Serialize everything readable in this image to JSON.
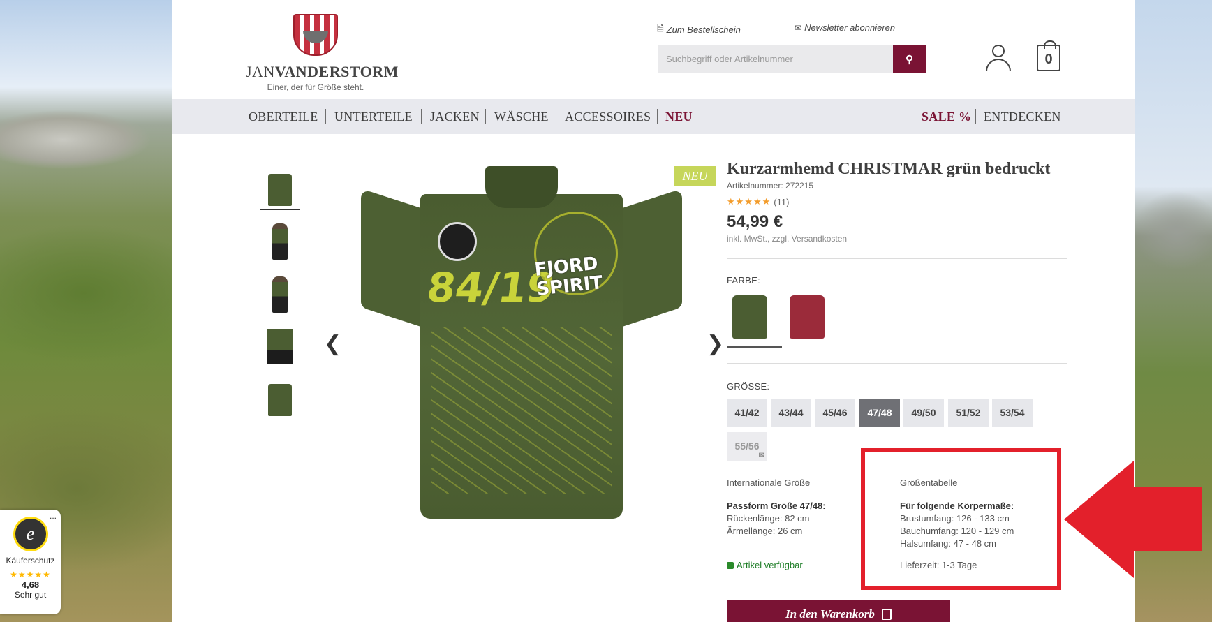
{
  "header": {
    "logo_name_light": "JAN",
    "logo_name_bold": "VANDERSTORM",
    "logo_tagline": "Einer, der für Größe steht.",
    "order_form_link": "Zum Bestellschein",
    "newsletter_link": "Newsletter abonnieren",
    "search_placeholder": "Suchbegriff oder Artikelnummer",
    "search_button_icon": "search-icon",
    "cart_count": "0"
  },
  "nav": {
    "left": [
      "OBERTEILE",
      "UNTERTEILE",
      "JACKEN",
      "WÄSCHE",
      "ACCESSOIRES",
      "NEU"
    ],
    "right": [
      "SALE %",
      "ENTDECKEN"
    ],
    "accent_color": "#7a1334"
  },
  "product": {
    "badge": "NEU",
    "title": "Kurzarmhemd CHRISTMAR grün bedruckt",
    "article_number": "Artikelnummer: 272215",
    "rating_stars": "★★★★★",
    "rating_count": "(11)",
    "price": "54,99 €",
    "vat_note": "inkl. MwSt., zzgl. Versandkosten",
    "print_number": "84/19",
    "print_text_1": "FJORD",
    "print_text_2": "SPIRIT",
    "color_label": "FARBE:",
    "colors": [
      {
        "name": "green",
        "hex": "#4b5d32"
      },
      {
        "name": "red",
        "hex": "#9b2b3a"
      }
    ],
    "size_label": "GRÖSSE:",
    "sizes": [
      "41/42",
      "43/44",
      "45/46",
      "47/48",
      "49/50",
      "51/52",
      "53/54",
      "55/56"
    ],
    "selected_size": "47/48",
    "unavailable_size": "55/56",
    "intl_size_link": "Internationale Größe",
    "size_table_link": "Größentabelle",
    "fit_title": "Passform Größe 47/48:",
    "fit_back_length": "Rückenlänge: 82 cm",
    "fit_sleeve_length": "Ärmellänge: 26 cm",
    "body_title": "Für folgende Körpermaße:",
    "chest": "Brustumfang: 126 - 133 cm",
    "waist": "Bauchumfang: 120 - 129 cm",
    "neck": "Halsumfang: 47 - 48 cm",
    "availability": "Artikel verfügbar",
    "delivery": "Lieferzeit: 1-3 Tage",
    "add_to_cart": "In den Warenkorb"
  },
  "trusted_shops": {
    "seal_letter": "e",
    "label": "Käuferschutz",
    "stars": "★★★★★",
    "score": "4,68",
    "text": "Sehr gut",
    "more": "..."
  },
  "carousel": {
    "prev": "❮",
    "next": "❯"
  },
  "annotation_color": "#e3202b"
}
